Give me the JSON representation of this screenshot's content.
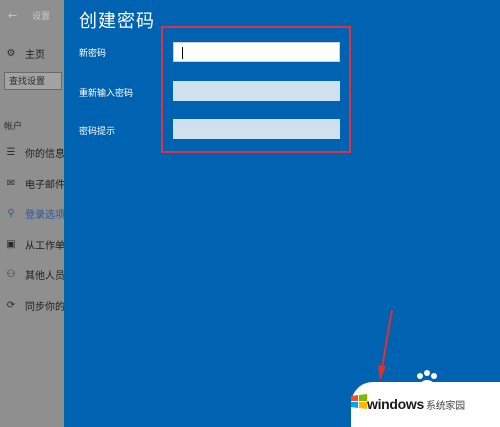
{
  "settings": {
    "title": "设置",
    "home_label": "主页",
    "search_placeholder": "查找设置",
    "section_label": "帐户",
    "nav_items": [
      {
        "label": "你的信息",
        "icon": "person-card-icon"
      },
      {
        "label": "电子邮件",
        "icon": "mail-icon"
      },
      {
        "label": "登录选项",
        "icon": "key-icon"
      },
      {
        "label": "从工作单",
        "icon": "briefcase-icon"
      },
      {
        "label": "其他人员",
        "icon": "person-icon"
      },
      {
        "label": "同步你的",
        "icon": "sync-icon"
      }
    ]
  },
  "dialog": {
    "title": "创建密码",
    "fields": [
      {
        "label": "新密码",
        "value": "",
        "state": "focused"
      },
      {
        "label": "重新输入密码",
        "value": "",
        "state": "normal"
      },
      {
        "label": "密码提示",
        "value": "",
        "state": "normal"
      }
    ]
  },
  "watermark": {
    "brand": "windows",
    "site": "系统家园"
  },
  "colors": {
    "dialog_bg": "#0063b1",
    "highlight": "#d9334a",
    "field_inactive": "#cfe1ef"
  }
}
